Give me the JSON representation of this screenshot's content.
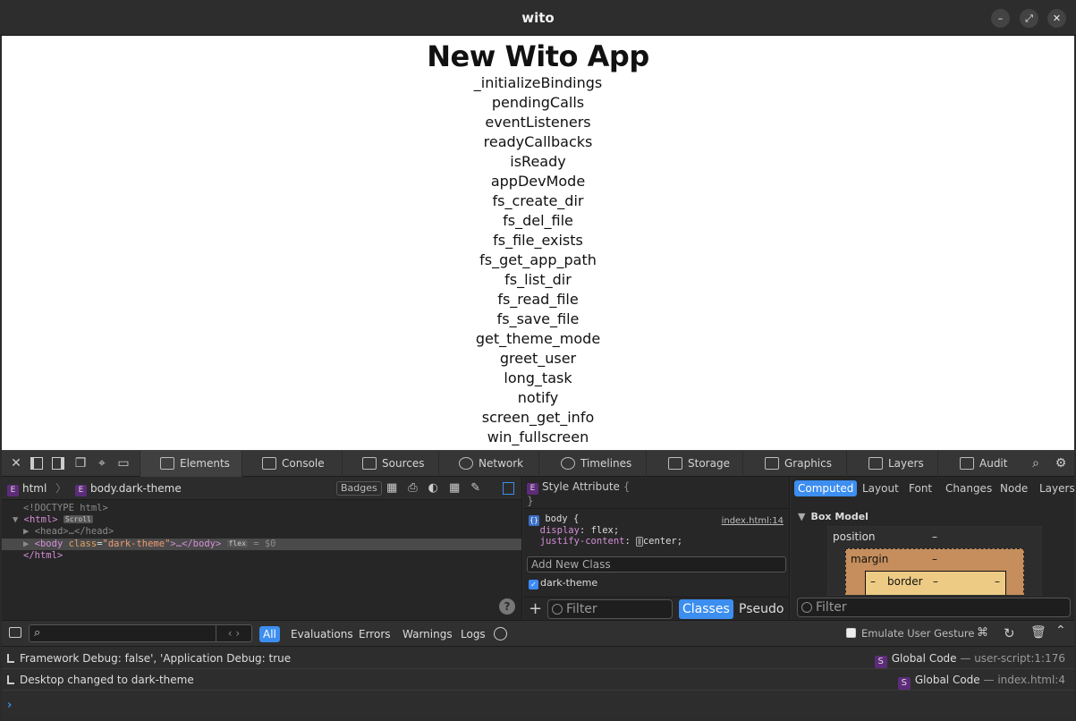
{
  "window": {
    "title": "wito"
  },
  "app": {
    "heading": "New Wito App",
    "functions": [
      "_initializeBindings",
      "pendingCalls",
      "eventListeners",
      "readyCallbacks",
      "isReady",
      "appDevMode",
      "fs_create_dir",
      "fs_del_file",
      "fs_file_exists",
      "fs_get_app_path",
      "fs_list_dir",
      "fs_read_file",
      "fs_save_file",
      "get_theme_mode",
      "greet_user",
      "long_task",
      "notify",
      "screen_get_info",
      "win_fullscreen"
    ]
  },
  "devtools": {
    "tabs": [
      "Elements",
      "Console",
      "Sources",
      "Network",
      "Timelines",
      "Storage",
      "Graphics",
      "Layers",
      "Audit"
    ],
    "breadcrumb": {
      "html": "html",
      "body": "body.dark-theme",
      "badges": "Badges",
      "badge_letter": "E"
    },
    "dom": {
      "doctype": "<!DOCTYPE html>",
      "html_open": "<html>",
      "scroll_pill": "Scroll",
      "head": "<head>…</head>",
      "body_open_tag": "<body",
      "body_attr": "class",
      "body_val": "\"dark-theme\"",
      "body_rest": ">…</body>",
      "flex_pill": "flex",
      "selected_ref": "= $0",
      "html_close": "</html>",
      "help": "?"
    },
    "styles": {
      "style_attribute": "Style Attribute",
      "open_brace": "{",
      "close_brace": "}",
      "selector": "body",
      "source": "index.html:14",
      "decl1_prop": "display",
      "decl1_val": "flex",
      "decl2_prop": "justify-content",
      "decl2_val": "center",
      "add_class_placeholder": "Add New Class",
      "class_name": "dark-theme",
      "filter_placeholder": "Filter",
      "classes_btn": "Classes",
      "pseudo_btn": "Pseudo"
    },
    "computed": {
      "tabs": [
        "Computed",
        "Layout",
        "Font",
        "Changes",
        "Node",
        "Layers"
      ],
      "box_model_title": "Box Model",
      "position_label": "position",
      "margin_label": "margin",
      "border_label": "border",
      "dash": "–",
      "filter_placeholder": "Filter"
    },
    "console": {
      "filters": [
        "All",
        "Evaluations",
        "Errors",
        "Warnings",
        "Logs"
      ],
      "emulate": "Emulate User Gesture",
      "messages": [
        {
          "text": "Framework Debug: false', 'Application Debug: true",
          "loc": "Global Code",
          "src": "— user-script:1:176"
        },
        {
          "text": "Desktop changed to dark-theme",
          "loc": "Global Code",
          "src": "— index.html:4"
        }
      ],
      "source_badge": "S",
      "prompt": "›"
    }
  }
}
